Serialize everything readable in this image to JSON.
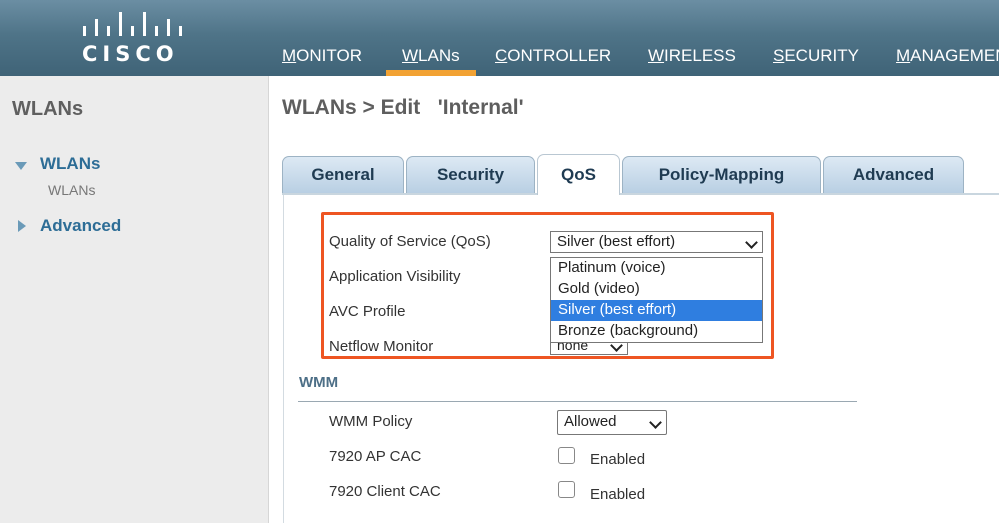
{
  "header": {
    "logo_text": "CISCO",
    "nav": [
      {
        "first": "M",
        "rest": "ONITOR"
      },
      {
        "first": "W",
        "rest": "LANs"
      },
      {
        "first": "C",
        "rest": "ONTROLLER"
      },
      {
        "first": "W",
        "rest": "IRELESS"
      },
      {
        "first": "S",
        "rest": "ECURITY"
      },
      {
        "first": "M",
        "rest": "ANAGEMEN"
      }
    ],
    "active_nav": "WLANs"
  },
  "sidebar": {
    "title": "WLANs",
    "items": [
      {
        "label": "WLANs",
        "expanded": true,
        "children": [
          "WLANs"
        ]
      },
      {
        "label": "Advanced",
        "expanded": false
      }
    ]
  },
  "page": {
    "title": "WLANs > Edit   'Internal'",
    "tabs": [
      "General",
      "Security",
      "QoS",
      "Policy-Mapping",
      "Advanced"
    ],
    "active_tab": "QoS"
  },
  "qos": {
    "qos_label": "Quality of Service (QoS)",
    "qos_value": "Silver (best effort)",
    "qos_options": [
      "Platinum (voice)",
      "Gold (video)",
      "Silver (best effort)",
      "Bronze (background)"
    ],
    "app_visibility_label": "Application Visibility",
    "avc_profile_label": "AVC Profile",
    "netflow_label": "Netflow Monitor",
    "netflow_value": "none"
  },
  "wmm": {
    "title": "WMM",
    "policy_label": "WMM Policy",
    "policy_value": "Allowed",
    "ap_cac_label": "7920 AP CAC",
    "client_cac_label": "7920 Client CAC",
    "enabled_label": "Enabled"
  },
  "colors": {
    "header": "#4f7488",
    "accent": "#f2a233",
    "highlight_border": "#ee5522",
    "selected_option": "#2f7ee0"
  }
}
